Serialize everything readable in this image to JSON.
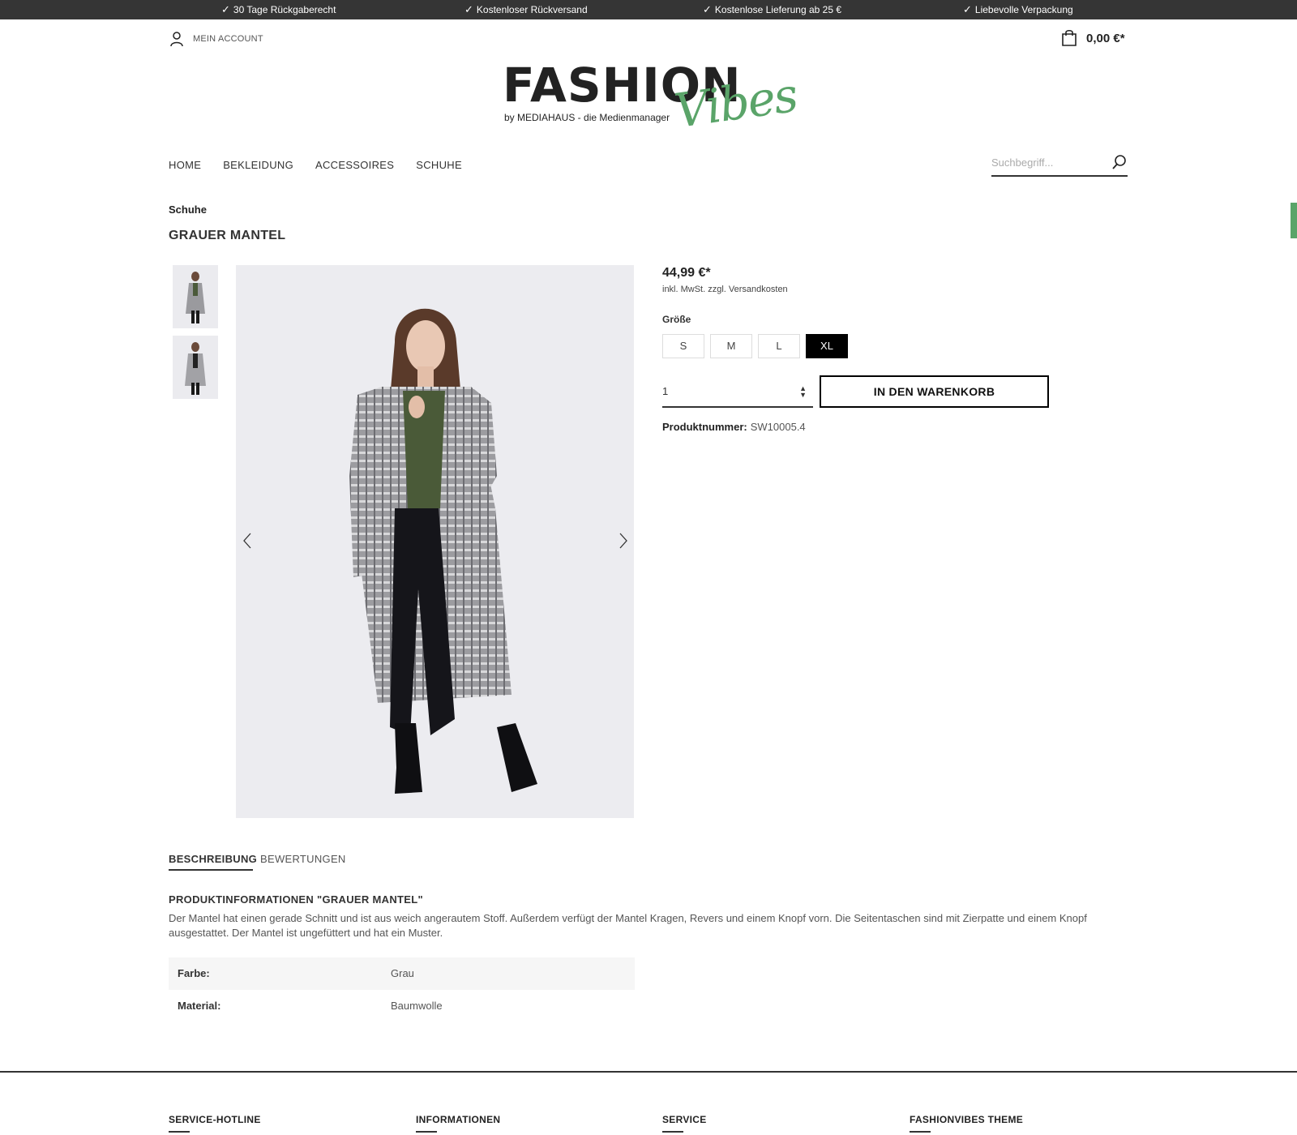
{
  "topbar": {
    "items": [
      "30 Tage Rückgaberecht",
      "Kostenloser Rückversand",
      "Kostenlose Lieferung ab 25 €",
      "Liebevolle Verpackung"
    ]
  },
  "header": {
    "account_label": "MEIN ACCOUNT",
    "cart_total": "0,00 €*",
    "logo_main": "FASHION",
    "logo_script": "Vibes",
    "logo_sub": "by MEDIAHAUS - die Medienmanager"
  },
  "nav": {
    "items": [
      "HOME",
      "BEKLEIDUNG",
      "ACCESSOIRES",
      "SCHUHE"
    ],
    "search_placeholder": "Suchbegriff..."
  },
  "product": {
    "breadcrumb": "Schuhe",
    "title": "GRAUER MANTEL",
    "price": "44,99 €*",
    "price_note": "inkl. MwSt. zzgl. Versandkosten",
    "size_label": "Größe",
    "sizes": [
      "S",
      "M",
      "L",
      "XL"
    ],
    "selected_size": "XL",
    "quantity": "1",
    "add_to_cart_label": "IN DEN WARENKORB",
    "product_number_label": "Produktnummer:",
    "product_number": "SW10005.4"
  },
  "tabs": {
    "description": "BESCHREIBUNG",
    "reviews": "BEWERTUNGEN",
    "active": "BESCHREIBUNG"
  },
  "description": {
    "title": "PRODUKTINFORMATIONEN \"GRAUER MANTEL\"",
    "text": "Der Mantel hat einen gerade Schnitt und ist aus weich angerautem Stoff. Außerdem verfügt der Mantel Kragen, Revers und einem Knopf vorn. Die Seitentaschen sind mit Zierpatte und einem Knopf ausgestattet. Der Mantel ist ungefüttert und hat ein Muster.",
    "properties": [
      {
        "label": "Farbe:",
        "value": "Grau"
      },
      {
        "label": "Material:",
        "value": "Baumwolle"
      }
    ]
  },
  "footer": {
    "columns": [
      "SERVICE-HOTLINE",
      "INFORMATIONEN",
      "SERVICE",
      "FASHIONVIBES THEME"
    ]
  },
  "colors": {
    "topbar_bg": "#353535",
    "accent_green": "#5aa469",
    "selected_size_bg": "#000000"
  },
  "icons": {
    "topbar": "check-icon",
    "account": "user-icon",
    "cart": "shopping-bag-icon",
    "search": "search-icon",
    "gallery_prev": "chevron-left-icon",
    "gallery_next": "chevron-right-icon",
    "quantity": "sort-caret-icon"
  }
}
